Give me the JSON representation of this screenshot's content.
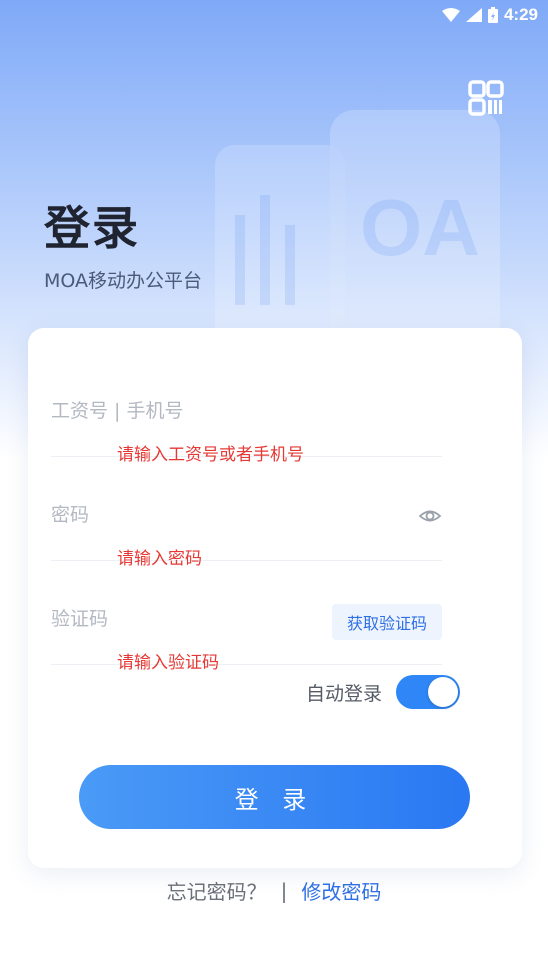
{
  "status_bar": {
    "time": "4:29"
  },
  "header": {
    "title": "登录",
    "subtitle": "MOA移动办公平台"
  },
  "form": {
    "account": {
      "placeholder": "工资号 | 手机号",
      "value": "",
      "error": "请输入工资号或者手机号"
    },
    "password": {
      "placeholder": "密码",
      "value": "",
      "error": "请输入密码"
    },
    "captcha": {
      "placeholder": "验证码",
      "value": "",
      "error": "请输入验证码",
      "get_code_label": "获取验证码"
    },
    "auto_login": {
      "label": "自动登录",
      "enabled": true
    },
    "submit_label": "登 录"
  },
  "footer": {
    "forgot_label": "忘记密码？",
    "separator": "|",
    "change_label": "修改密码"
  },
  "colors": {
    "accent": "#2f86f6",
    "error": "#e53935",
    "link": "#2f6fe4"
  }
}
